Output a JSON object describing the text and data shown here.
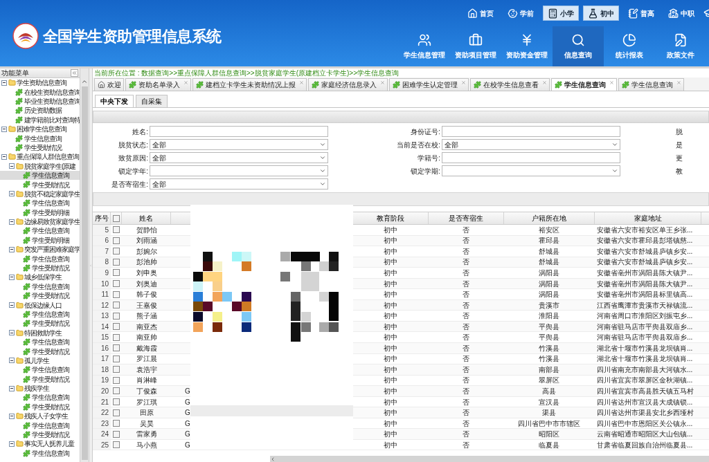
{
  "header": {
    "title": "全国学生资助管理信息系统",
    "levels": [
      {
        "label": "首页",
        "selected": false
      },
      {
        "label": "学前",
        "selected": false
      },
      {
        "label": "小学",
        "selected": true
      },
      {
        "label": "初中",
        "selected": true
      },
      {
        "label": "普高",
        "selected": false
      },
      {
        "label": "中职",
        "selected": false
      }
    ],
    "nav": [
      {
        "label": "学生信息管理",
        "selected": false
      },
      {
        "label": "资助项目管理",
        "selected": false
      },
      {
        "label": "资助资金管理",
        "selected": false
      },
      {
        "label": "信息查询",
        "selected": true
      },
      {
        "label": "统计报表",
        "selected": false
      },
      {
        "label": "政策文件",
        "selected": false
      }
    ]
  },
  "sidebar": {
    "title": "功能菜单",
    "tree": [
      {
        "label": "学生资助信息查询",
        "expanded": true,
        "children": [
          {
            "label": "在校生资助信息查询",
            "selected": false
          },
          {
            "label": "毕业生资助信息查询",
            "selected": false
          },
          {
            "label": "历史资助数据",
            "selected": false
          },
          {
            "label": "建学籍前比对查询特",
            "selected": false
          }
        ]
      },
      {
        "label": "困难学生信息查询",
        "expanded": true,
        "children": [
          {
            "label": "学生信息查询",
            "selected": false
          },
          {
            "label": "学生受助情况",
            "selected": false
          }
        ]
      },
      {
        "label": "重点保障人群信息查询",
        "expanded": true,
        "children": [
          {
            "label": "脱贫家庭学生(原建",
            "expanded": true,
            "children": [
              {
                "label": "学生信息查询",
                "selected": true
              },
              {
                "label": "学生受助情况",
                "selected": false
              }
            ]
          },
          {
            "label": "脱贫不稳定家庭学生",
            "expanded": true,
            "children": [
              {
                "label": "学生信息查询",
                "selected": false
              },
              {
                "label": "学生受助明细",
                "selected": false
              }
            ]
          },
          {
            "label": "边缘易致贫家庭学生",
            "expanded": true,
            "children": [
              {
                "label": "学生信息查询",
                "selected": false
              },
              {
                "label": "学生受助明细",
                "selected": false
              }
            ]
          },
          {
            "label": "突发严重困难家庭学",
            "expanded": true,
            "children": [
              {
                "label": "学生信息查询",
                "selected": false
              },
              {
                "label": "学生受助情况",
                "selected": false
              }
            ]
          },
          {
            "label": "城乡低保学生",
            "expanded": true,
            "children": [
              {
                "label": "学生信息查询",
                "selected": false
              },
              {
                "label": "学生受助情况",
                "selected": false
              }
            ]
          },
          {
            "label": "低保边缘人口",
            "expanded": true,
            "children": [
              {
                "label": "学生信息查询",
                "selected": false
              },
              {
                "label": "学生受助情况",
                "selected": false
              }
            ]
          },
          {
            "label": "特困救助学生",
            "expanded": true,
            "children": [
              {
                "label": "学生信息查询",
                "selected": false
              },
              {
                "label": "学生受助情况",
                "selected": false
              }
            ]
          },
          {
            "label": "孤儿学生",
            "expanded": true,
            "children": [
              {
                "label": "学生信息查询",
                "selected": false
              },
              {
                "label": "学生受助情况",
                "selected": false
              }
            ]
          },
          {
            "label": "残疾学生",
            "expanded": true,
            "children": [
              {
                "label": "学生信息查询",
                "selected": false
              },
              {
                "label": "学生受助情况",
                "selected": false
              }
            ]
          },
          {
            "label": "残疾人子女学生",
            "expanded": true,
            "children": [
              {
                "label": "学生信息查询",
                "selected": false
              },
              {
                "label": "学生受助情况",
                "selected": false
              }
            ]
          },
          {
            "label": "事实无人抚养儿童",
            "expanded": true,
            "children": [
              {
                "label": "学生信息查询",
                "selected": false
              }
            ]
          }
        ]
      }
    ]
  },
  "breadcrumb": "当前所在位置 : 数据查询>>重点保障人群信息查询>>脱贫家庭学生(原建档立卡学生)>>学生信息查询",
  "tabs": [
    {
      "label": "欢迎",
      "kind": "home",
      "selected": false
    },
    {
      "label": "资助名单录入",
      "kind": "page",
      "selected": false
    },
    {
      "label": "建档立卡学生未资助情况上报",
      "kind": "page",
      "selected": false
    },
    {
      "label": "家庭经济信息录入",
      "kind": "page",
      "selected": false
    },
    {
      "label": "困难学生认定管理",
      "kind": "page",
      "selected": false
    },
    {
      "label": "在校学生信息查看",
      "kind": "page",
      "selected": false
    },
    {
      "label": "学生信息查询",
      "kind": "page",
      "selected": true
    },
    {
      "label": "学生信息查询",
      "kind": "page",
      "selected": false
    }
  ],
  "subtabs": [
    {
      "label": "中央下发",
      "selected": true
    },
    {
      "label": "自采集",
      "selected": false
    }
  ],
  "form": {
    "columns": [
      [
        {
          "label": "姓名:",
          "kind": "text"
        },
        {
          "label": "脱贫状态:",
          "kind": "select",
          "value": "全部"
        },
        {
          "label": "致贫原因:",
          "kind": "select",
          "value": "全部"
        },
        {
          "label": "锁定学年:",
          "kind": "select"
        },
        {
          "label": "是否寄宿生:",
          "kind": "select",
          "value": "全部"
        }
      ],
      [
        {
          "label": "身份证号:",
          "kind": "text"
        },
        {
          "label": "当前是否在校:",
          "kind": "select",
          "value": "全部"
        },
        {
          "label": "学籍号:",
          "kind": "text"
        },
        {
          "label": "锁定学期:",
          "kind": "select"
        }
      ],
      [
        {
          "label": "脱",
          "kind": "label"
        },
        {
          "label": "是",
          "kind": "label"
        },
        {
          "label": "更",
          "kind": "label"
        },
        {
          "label": "教",
          "kind": "label"
        }
      ]
    ]
  },
  "table": {
    "columns": [
      "序号",
      "姓名",
      "教育阶段",
      "是否寄宿生",
      "户籍所在地",
      "家庭地址"
    ],
    "all_checked": false,
    "rows": [
      {
        "no": "5",
        "checked": false,
        "name": "贺静怡",
        "stage": "初中",
        "boarding": "否",
        "huji": "裕安区",
        "address": "安徽省六安市裕安区单王乡张..."
      },
      {
        "no": "6",
        "checked": false,
        "name": "刘雨涵",
        "stage": "初中",
        "boarding": "否",
        "huji": "霍邱县",
        "address": "安徽省六安市霍邱县彭塔镇慈..."
      },
      {
        "no": "7",
        "checked": false,
        "name": "彭婉尔",
        "stage": "初中",
        "boarding": "否",
        "huji": "舒城县",
        "address": "安徽省六安市舒城县庐镇乡安..."
      },
      {
        "no": "8",
        "checked": false,
        "name": "彭池帅",
        "stage": "初中",
        "boarding": "否",
        "huji": "舒城县",
        "address": "安徽省六安市舒城县庐镇乡安..."
      },
      {
        "no": "9",
        "checked": false,
        "name": "刘申奥",
        "stage": "初中",
        "boarding": "否",
        "huji": "涡阳县",
        "address": "安徽省亳州市涡阳县陈大镇尹..."
      },
      {
        "no": "10",
        "checked": false,
        "name": "刘奥迪",
        "stage": "初中",
        "boarding": "否",
        "huji": "涡阳县",
        "address": "安徽省亳州市涡阳县陈大镇尹..."
      },
      {
        "no": "11",
        "checked": false,
        "name": "韩子俊",
        "stage": "初中",
        "boarding": "否",
        "huji": "涡阳县",
        "address": "安徽省亳州市涡阳县标里镇高..."
      },
      {
        "no": "12",
        "checked": false,
        "name": "王嘉俊",
        "stage": "初中",
        "boarding": "否",
        "huji": "贵溪市",
        "address": "江西省鹰潭市贵溪市天禄镇流..."
      },
      {
        "no": "13",
        "checked": false,
        "name": "熊子涵",
        "stage": "初中",
        "boarding": "否",
        "huji": "淮阳县",
        "address": "河南省周口市淮阳区刘振屯乡..."
      },
      {
        "no": "14",
        "checked": false,
        "name": "南亚杰",
        "stage": "初中",
        "boarding": "否",
        "huji": "平舆县",
        "address": "河南省驻马店市平舆县双庙乡..."
      },
      {
        "no": "15",
        "checked": false,
        "name": "南亚帅",
        "stage": "初中",
        "boarding": "否",
        "huji": "平舆县",
        "address": "河南省驻马店市平舆县双庙乡..."
      },
      {
        "no": "16",
        "checked": false,
        "name": "戴海霞",
        "stage": "初中",
        "boarding": "否",
        "huji": "竹溪县",
        "address": "湖北省十堰市竹溪县龙坝镇肖..."
      },
      {
        "no": "17",
        "checked": false,
        "name": "罗江晨",
        "stage": "初中",
        "boarding": "否",
        "huji": "竹溪县",
        "address": "湖北省十堰市竹溪县龙坝镇肖..."
      },
      {
        "no": "18",
        "checked": false,
        "name": "袁浩宇",
        "stage": "初中",
        "boarding": "否",
        "huji": "南部县",
        "address": "四川省南充市南部县大河镇水..."
      },
      {
        "no": "19",
        "checked": false,
        "name": "肖淋峰",
        "stage": "初中",
        "boarding": "否",
        "huji": "翠屏区",
        "address": "四川省宜宾市翠屏区金秋湖镇..."
      },
      {
        "no": "20",
        "checked": false,
        "name": "丁俊森",
        "column_3": "G",
        "stage": "初中",
        "boarding": "否",
        "huji": "高县",
        "address": "四川省宜宾市高县胜天镇五马村"
      },
      {
        "no": "21",
        "checked": false,
        "name": "罗江琪",
        "column_3": "G",
        "stage": "初中",
        "boarding": "否",
        "huji": "宣汉县",
        "address": "四川省达州市宣汉县大成镇锁..."
      },
      {
        "no": "22",
        "checked": false,
        "name": "田原",
        "column_3": "G",
        "stage": "初中",
        "boarding": "否",
        "huji": "渠县",
        "address": "四川省达州市渠县安北乡西垭村"
      },
      {
        "no": "23",
        "checked": false,
        "name": "吴昊",
        "column_3": "G",
        "stage": "初中",
        "boarding": "否",
        "huji": "四川省巴中市市辖区",
        "address": "四川省巴中市恩阳区关公镇永..."
      },
      {
        "no": "24",
        "checked": false,
        "name": "雷家勇",
        "column_3": "G",
        "stage": "初中",
        "boarding": "否",
        "huji": "昭阳区",
        "address": "云南省昭通市昭阳区大山包镇..."
      },
      {
        "no": "25",
        "checked": false,
        "name": "马小燕",
        "column_3": "G",
        "stage": "初中",
        "boarding": "否",
        "huji": "临夏县",
        "address": "甘肃省临夏回族自治州临夏县..."
      }
    ]
  }
}
